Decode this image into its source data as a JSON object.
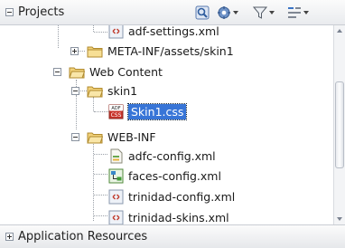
{
  "header": {
    "title": "Projects",
    "toolbar_icons": [
      "locate-icon",
      "project-settings-icon",
      "filter-icon",
      "sort-icon"
    ]
  },
  "tree": {
    "items": [
      {
        "label": "adf-settings.xml",
        "icon": "xml-file-icon"
      },
      {
        "label": "META-INF/assets/skin1",
        "icon": "folder-icon"
      },
      {
        "label": "Web Content",
        "icon": "folder-icon"
      },
      {
        "label": "skin1",
        "icon": "folder-icon"
      },
      {
        "label": "Skin1.css",
        "icon": "css-file-icon",
        "selected": true
      },
      {
        "label": "WEB-INF",
        "icon": "folder-icon"
      },
      {
        "label": "adfc-config.xml",
        "icon": "adfc-config-icon"
      },
      {
        "label": "faces-config.xml",
        "icon": "faces-config-icon"
      },
      {
        "label": "trinidad-config.xml",
        "icon": "xml-file-icon"
      },
      {
        "label": "trinidad-skins.xml",
        "icon": "xml-file-icon"
      }
    ]
  },
  "footer": {
    "title": "Application Resources"
  },
  "colors": {
    "selection": "#3875d7",
    "folder": "#f2d27a"
  }
}
